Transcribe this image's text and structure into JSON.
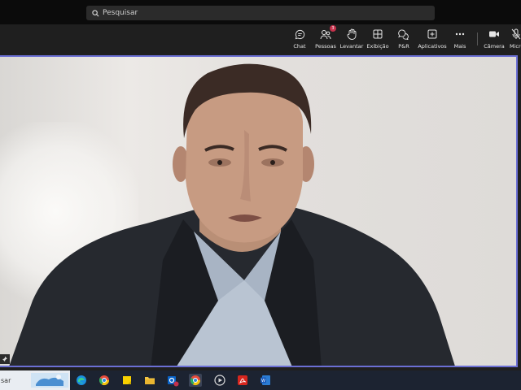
{
  "search": {
    "placeholder": "Pesquisar"
  },
  "toolbar": {
    "items": [
      {
        "label": "Chat",
        "icon": "chat-icon"
      },
      {
        "label": "Pessoas",
        "icon": "people-icon",
        "badge": "3"
      },
      {
        "label": "Levantar",
        "icon": "raise-hand-icon"
      },
      {
        "label": "Exibição",
        "icon": "view-icon"
      },
      {
        "label": "P&R",
        "icon": "qa-icon"
      },
      {
        "label": "Aplicativos",
        "icon": "apps-icon"
      },
      {
        "label": "Mais",
        "icon": "more-icon"
      },
      {
        "label": "Câmera",
        "icon": "camera-icon"
      },
      {
        "label": "Micro",
        "icon": "mic-icon"
      }
    ]
  },
  "taskbar": {
    "search_text": "sar",
    "apps": [
      "edge-icon",
      "chrome-icon",
      "sticky-notes-icon",
      "file-explorer-icon",
      "outlook-icon",
      "chrome-icon",
      "media-player-icon",
      "acrobat-icon",
      "word-icon"
    ],
    "outlook_badge": "1"
  },
  "colors": {
    "accent": "#6b6fd4",
    "badge": "#c4314b",
    "taskbar": "#1c2331"
  }
}
